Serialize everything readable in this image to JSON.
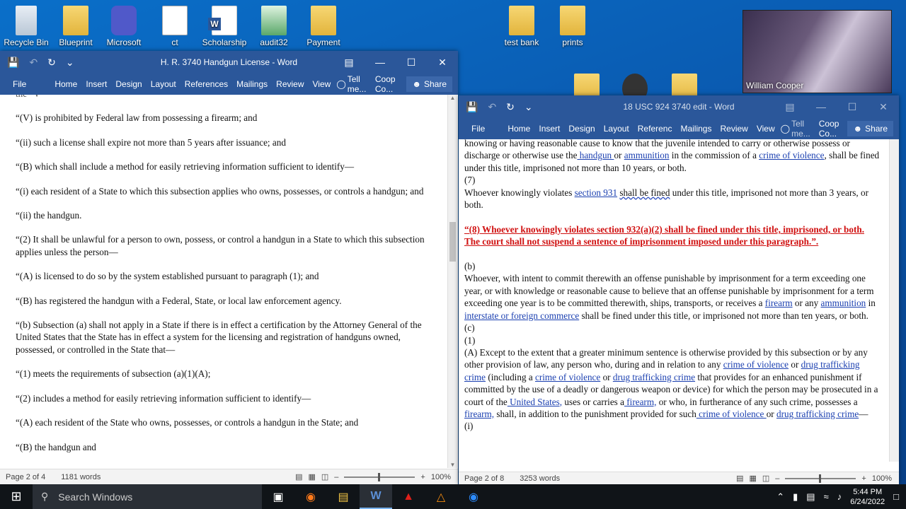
{
  "desktop": {
    "icons": [
      {
        "label": "Recycle Bin",
        "icon": "recycle-bin-icon"
      },
      {
        "label": "Blueprint",
        "icon": "folder-icon"
      },
      {
        "label": "Microsoft",
        "icon": "teams-icon"
      },
      {
        "label": "ct",
        "icon": "document-icon"
      },
      {
        "label": "Scholarship",
        "icon": "word-doc-icon"
      },
      {
        "label": "audit32",
        "icon": "installer-icon"
      },
      {
        "label": "Payment",
        "icon": "folder-icon"
      },
      {
        "label": "test bank",
        "icon": "zip-folder-icon"
      },
      {
        "label": "prints",
        "icon": "folder-icon"
      }
    ]
  },
  "webcam": {
    "name": "William Cooper"
  },
  "win1": {
    "title": "H. R. 3740  Handgun License  -  Word",
    "tabs": [
      "File",
      "Home",
      "Insert",
      "Design",
      "Layout",
      "References",
      "Mailings",
      "Review",
      "View"
    ],
    "tell": "Tell me...",
    "user": "Coop Co...",
    "share": "Share",
    "paras": [
      "the “V”",
      "“(V) is prohibited by Federal law from possessing a firearm; and",
      "“(ii) such a license shall expire not more than 5 years after issuance; and",
      "“(B) which shall include a method for easily retrieving information sufficient to identify—",
      "“(i) each resident of a State to which this subsection applies who owns, possesses, or controls a handgun; and",
      "“(ii) the handgun.",
      "“(2) It shall be unlawful for a person to own, possess, or control a handgun in a State to which this subsection applies unless the person—",
      "“(A) is licensed to do so by the system established pursuant to paragraph (1); and",
      "“(B) has registered the handgun with a Federal, State, or local law enforcement agency.",
      "“(b) Subsection (a) shall not apply in a State if there is in effect a certification by the Attorney General of the United States that the State has in effect a system for the licensing and registration of handguns owned, possessed, or controlled in the State that—",
      "“(1) meets the requirements of subsection (a)(1)(A);",
      "“(2) includes a method for easily retrieving information sufficient to identify—",
      "“(A) each resident of the State who owns, possesses, or controls a handgun in the State; and",
      "“(B) the handgun and"
    ],
    "page": "Page 2 of 4",
    "words": "1181 words",
    "zoom": "100%"
  },
  "win2": {
    "title": "18 USC 924 3740 edit  -  Word",
    "tabs": [
      "File",
      "Home",
      "Insert",
      "Design",
      "Layout",
      "Referenc",
      "Mailings",
      "Review",
      "View"
    ],
    "tell": "Tell me...",
    "user": "Coop Co...",
    "share": "Share",
    "page": "Page 2 of 8",
    "words": "3253 words",
    "zoom": "100%"
  },
  "taskbar": {
    "search": "Search Windows",
    "time": "5:44 PM",
    "date": "6/24/2022"
  }
}
